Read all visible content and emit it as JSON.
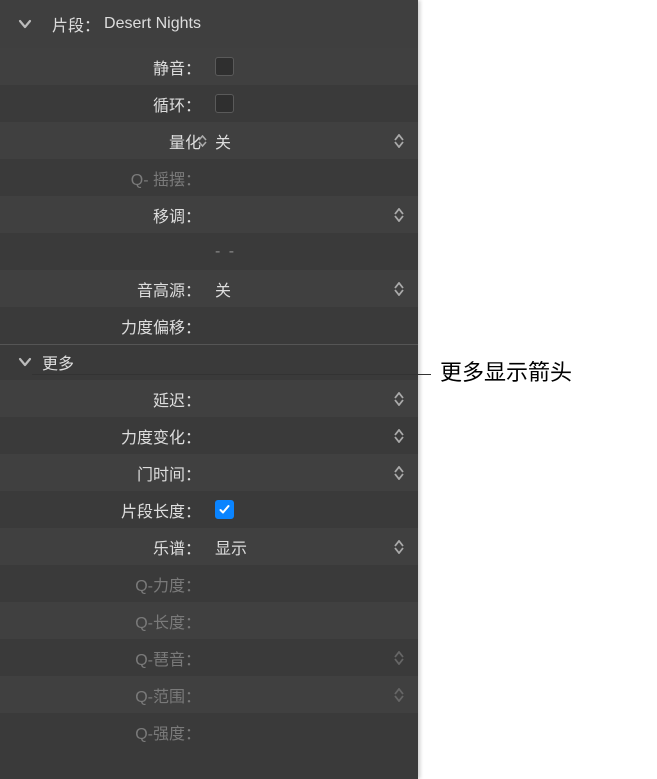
{
  "header": {
    "label": "片段：",
    "value": "Desert Nights"
  },
  "rows": {
    "mute": {
      "label": "静音："
    },
    "loop": {
      "label": "循环："
    },
    "quantize": {
      "label": "量化",
      "value": "关"
    },
    "qswing": {
      "label": "Q- 摇摆："
    },
    "transpose": {
      "label": "移调："
    },
    "dash": {
      "value": "-  -"
    },
    "pitchsource": {
      "label": "音高源：",
      "value": "关"
    },
    "velocityoffset": {
      "label": "力度偏移："
    }
  },
  "more": {
    "label": "更多"
  },
  "moreRows": {
    "delay": {
      "label": "延迟："
    },
    "velocitychange": {
      "label": "力度变化："
    },
    "gatetime": {
      "label": "门时间："
    },
    "cliplength": {
      "label": "片段长度："
    },
    "score": {
      "label": "乐谱：",
      "value": "显示"
    },
    "qvelocity": {
      "label": "Q-力度："
    },
    "qlength": {
      "label": "Q-长度："
    },
    "qarp": {
      "label": "Q-琶音："
    },
    "qrange": {
      "label": "Q-范围："
    },
    "qstrength": {
      "label": "Q-强度："
    }
  },
  "callout": "更多显示箭头"
}
